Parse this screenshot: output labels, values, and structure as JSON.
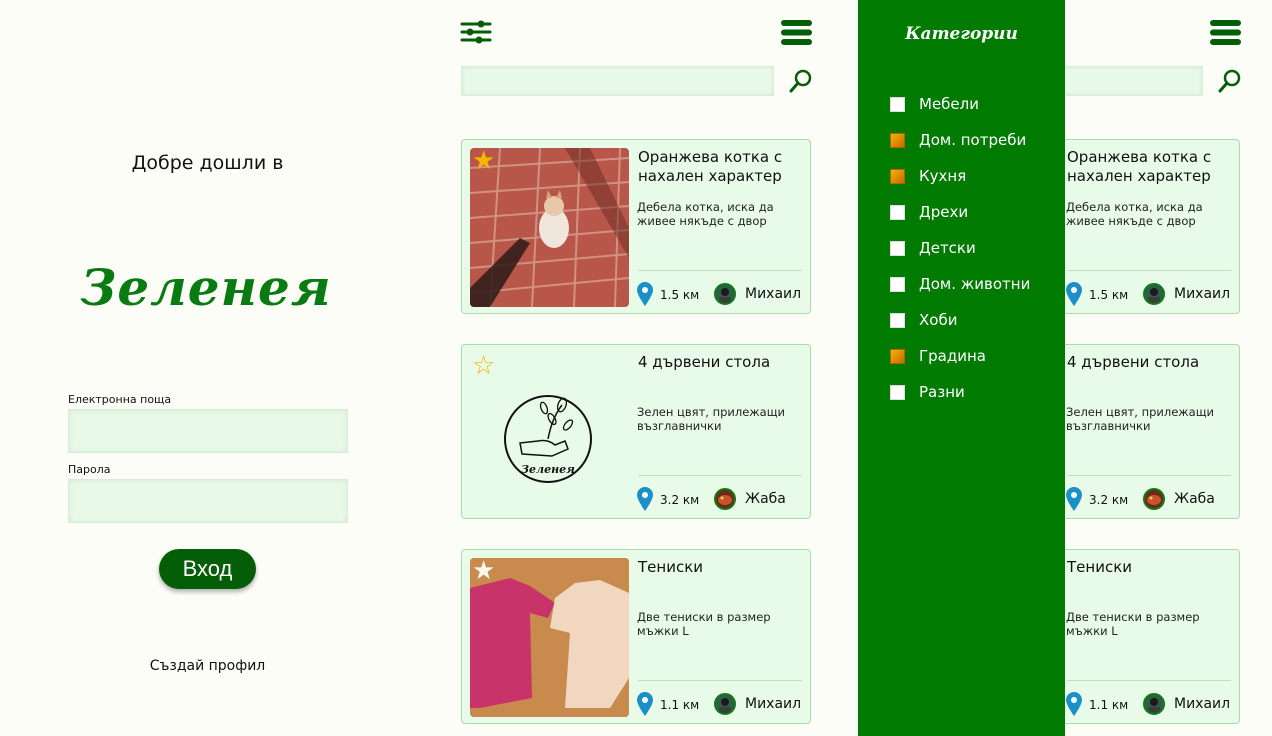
{
  "login": {
    "welcome": "Добре дошли в",
    "brand": "Зеленея",
    "email_label": "Електронна поща",
    "email_value": "",
    "password_label": "Парола",
    "password_value": "",
    "login_button": "Вход",
    "create_profile": "Създай профил"
  },
  "listing": {
    "search_value": "",
    "items": [
      {
        "title": "Оранжева котка с нахален характер",
        "description": "Дебела котка, иска да живее някъде с двор",
        "distance": "1.5 км",
        "user": "Михаил",
        "favorite": true
      },
      {
        "title": "4 дървени стола",
        "description": "Зелен цвят, прилежащи възглавнички",
        "distance": "3.2 км",
        "user": "Жаба",
        "favorite": false,
        "image_logo_text": "Зеленея"
      },
      {
        "title": "Тениски",
        "description": "Две тениски в размер мъжки L",
        "distance": "1.1 км",
        "user": "Михаил",
        "favorite": true
      }
    ]
  },
  "drawer": {
    "title": "Категории",
    "categories": [
      {
        "label": "Мебели",
        "checked": false
      },
      {
        "label": "Дом. потреби",
        "checked": true
      },
      {
        "label": "Кухня",
        "checked": true
      },
      {
        "label": "Дрехи",
        "checked": false
      },
      {
        "label": "Детски",
        "checked": false
      },
      {
        "label": "Дом. животни",
        "checked": false
      },
      {
        "label": "Хоби",
        "checked": false
      },
      {
        "label": "Градина",
        "checked": true
      },
      {
        "label": "Разни",
        "checked": false
      }
    ]
  },
  "colors": {
    "brand_green": "#0a7a12",
    "drawer_green": "#017a02",
    "button_green": "#045d07",
    "card_bg": "#e8fbe8",
    "star_gold": "#f5b400",
    "pin_blue": "#1b8fc7"
  },
  "icons": [
    "filter-sliders-icon",
    "hamburger-menu-icon",
    "search-icon",
    "star-icon",
    "location-pin-icon",
    "avatar"
  ]
}
